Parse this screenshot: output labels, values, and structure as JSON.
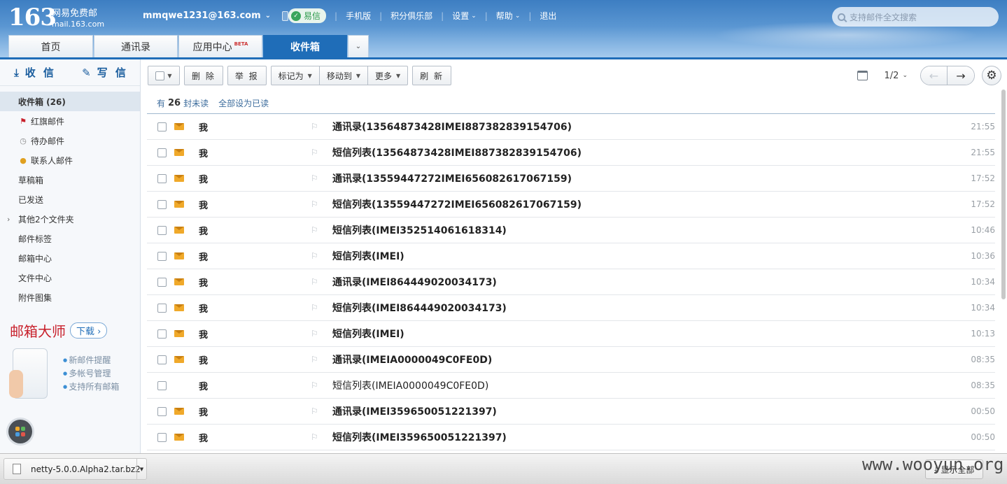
{
  "header": {
    "logo_num": "163",
    "logo_cn": "网易免费邮",
    "logo_en": "mail.163.com",
    "account": "mmqwe1231@163.com",
    "nav": {
      "yixin": "易信",
      "mobile": "手机版",
      "club": "积分俱乐部",
      "settings": "设置",
      "help": "帮助",
      "logout": "退出"
    },
    "search_placeholder": "支持邮件全文搜索"
  },
  "tabs": [
    {
      "label": "首页"
    },
    {
      "label": "通讯录"
    },
    {
      "label": "应用中心",
      "badge": "BETA"
    },
    {
      "label": "收件箱"
    }
  ],
  "sidebar": {
    "receive": "收 信",
    "compose": "写 信",
    "items": [
      {
        "label": "收件箱 (26)"
      },
      {
        "label": "红旗邮件"
      },
      {
        "label": "待办邮件"
      },
      {
        "label": "联系人邮件"
      },
      {
        "label": "草稿箱"
      },
      {
        "label": "已发送"
      },
      {
        "label": "其他2个文件夹"
      },
      {
        "label": "邮件标签"
      },
      {
        "label": "邮箱中心"
      },
      {
        "label": "文件中心"
      },
      {
        "label": "附件图集"
      }
    ],
    "promo": {
      "title": "邮箱大师",
      "download": "下载",
      "features": [
        "新邮件提醒",
        "多帐号管理",
        "支持所有邮箱"
      ]
    }
  },
  "toolbar": {
    "delete": "删 除",
    "report": "举 报",
    "mark_as": "标记为",
    "move_to": "移动到",
    "more": "更多",
    "refresh": "刷 新",
    "pager": "1/2"
  },
  "unread": {
    "prefix": "有",
    "count": "26",
    "suffix": "封未读",
    "mark_all": "全部设为已读"
  },
  "colors": {
    "brand_blue": "#1f6db8",
    "envelope": "#f0a92a",
    "flag_red": "#c8202b"
  },
  "mails": [
    {
      "sender": "我",
      "subject": "通讯录(13564873428IMEI887382839154706)",
      "time": "21:55",
      "unread": true
    },
    {
      "sender": "我",
      "subject": "短信列表(13564873428IMEI887382839154706)",
      "time": "21:55",
      "unread": true
    },
    {
      "sender": "我",
      "subject": "通讯录(13559447272IMEI656082617067159)",
      "time": "17:52",
      "unread": true
    },
    {
      "sender": "我",
      "subject": "短信列表(13559447272IMEI656082617067159)",
      "time": "17:52",
      "unread": true
    },
    {
      "sender": "我",
      "subject": "短信列表(IMEI352514061618314)",
      "time": "10:46",
      "unread": true
    },
    {
      "sender": "我",
      "subject": "短信列表(IMEI)",
      "time": "10:36",
      "unread": true
    },
    {
      "sender": "我",
      "subject": "通讯录(IMEI864449020034173)",
      "time": "10:34",
      "unread": true
    },
    {
      "sender": "我",
      "subject": "短信列表(IMEI864449020034173)",
      "time": "10:34",
      "unread": true
    },
    {
      "sender": "我",
      "subject": "短信列表(IMEI)",
      "time": "10:13",
      "unread": true
    },
    {
      "sender": "我",
      "subject": "通讯录(IMEIA0000049C0FE0D)",
      "time": "08:35",
      "unread": true
    },
    {
      "sender": "我",
      "subject": "短信列表(IMEIA0000049C0FE0D)",
      "time": "08:35",
      "unread": false
    },
    {
      "sender": "我",
      "subject": "通讯录(IMEI359650051221397)",
      "time": "00:50",
      "unread": true
    },
    {
      "sender": "我",
      "subject": "短信列表(IMEI359650051221397)",
      "time": "00:50",
      "unread": true
    }
  ],
  "download_bar": {
    "file": "netty-5.0.0.Alpha2.tar.bz2",
    "show_all": "显示全部"
  },
  "watermark": "www.wooyun.org"
}
